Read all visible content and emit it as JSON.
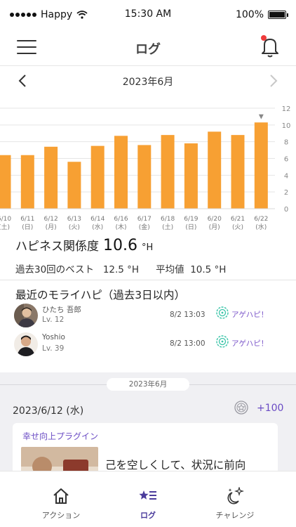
{
  "status_bar": {
    "carrier": "Happy",
    "time": "15:30 AM",
    "battery": "100%"
  },
  "header": {
    "title": "ログ"
  },
  "month_nav": {
    "label": "2023年6月"
  },
  "chart_data": {
    "type": "bar",
    "categories": [
      "6/10\n(土)",
      "6/11\n(日)",
      "6/12\n(月)",
      "6/13\n(火)",
      "6/14\n(水)",
      "6/16\n(木)",
      "6/17\n(金)",
      "6/18\n(土)",
      "6/19\n(日)",
      "6/20\n(月)",
      "6/21\n(火)",
      "6/22\n(水)"
    ],
    "dates": [
      "6/10",
      "6/11",
      "6/12",
      "6/13",
      "6/14",
      "6/16",
      "6/17",
      "6/18",
      "6/19",
      "6/20",
      "6/21",
      "6/22"
    ],
    "weekdays": [
      "(土)",
      "(日)",
      "(月)",
      "(火)",
      "(水)",
      "(木)",
      "(金)",
      "(土)",
      "(日)",
      "(月)",
      "(火)",
      "(水)"
    ],
    "values": [
      6.4,
      6.4,
      7.4,
      5.6,
      7.5,
      8.7,
      7.6,
      8.8,
      7.8,
      9.2,
      8.8,
      10.3
    ],
    "ylim": [
      0,
      12
    ],
    "yticks": [
      "0",
      "2",
      "4",
      "6",
      "8",
      "10",
      "12"
    ],
    "bar_color": "#f7a033",
    "grid": true,
    "marker": "▼"
  },
  "metric": {
    "label": "ハピネス関係度",
    "value": "10.6",
    "unit": "°H",
    "best_label": "過去30回のベスト",
    "best_value": "12.5 °H",
    "avg_label": "平均値",
    "avg_value": "10.5 °H"
  },
  "recent": {
    "title": "最近のモライハピ（過去3日以内）",
    "items": [
      {
        "name": "ひたち 吾郎",
        "level": "Lv. 12",
        "time": "8/2 13:03",
        "action": "アゲハピ！"
      },
      {
        "name": "Yoshio",
        "level": "Lv. 39",
        "time": "8/2 13:00",
        "action": "アゲハピ！"
      }
    ]
  },
  "log": {
    "month_pill": "2023年6月",
    "entry_date": "2023/6/12 (水)",
    "points": "+100",
    "card_tag": "幸せ向上プラグイン",
    "card_text": "己を空しくして、状況に前向"
  },
  "tabs": [
    {
      "label": "アクション",
      "icon": "house-icon",
      "active": false
    },
    {
      "label": "ログ",
      "icon": "star-list-icon",
      "active": true
    },
    {
      "label": "チャレンジ",
      "icon": "sparkle-moon-icon",
      "active": false
    }
  ],
  "colors": {
    "accent": "#6a4bc4",
    "bar": "#f7a033",
    "notification": "#ef3b3b",
    "agehapi": "#3cc5a9"
  }
}
